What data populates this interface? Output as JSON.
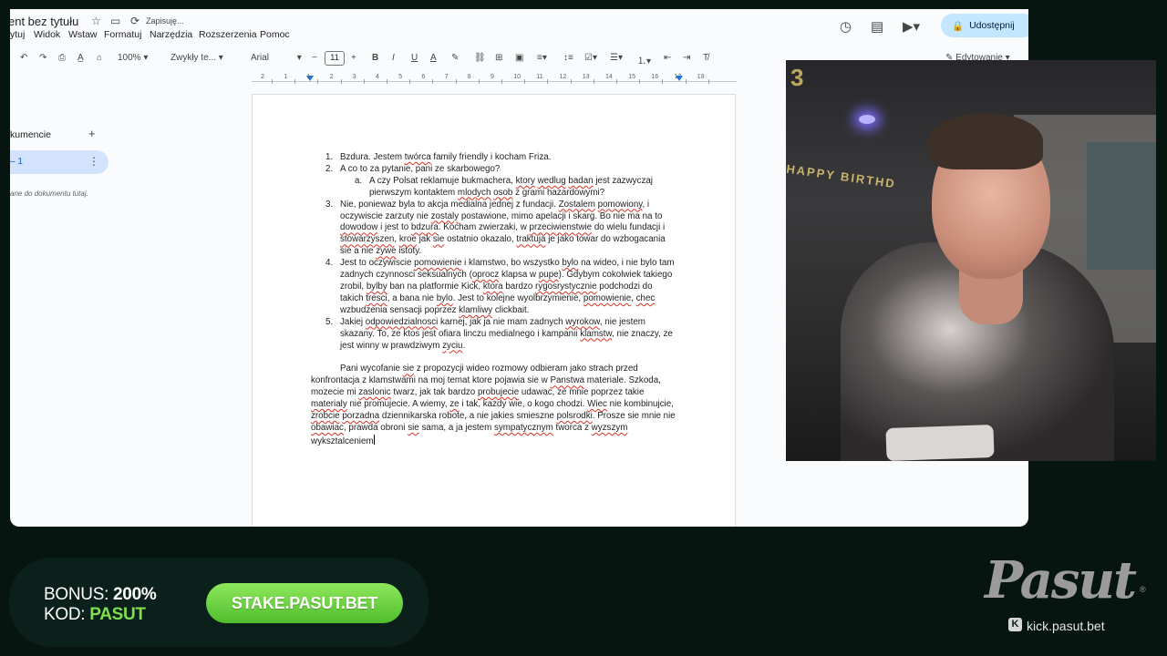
{
  "docs": {
    "title": "ent bez tytułu",
    "saving": "Zapisuję...",
    "menu": [
      "ytuj",
      "Widok",
      "Wstaw",
      "Formatuj",
      "Narzędzia",
      "Rozszerzenia",
      "Pomoc"
    ],
    "share_label": "Udostępnij",
    "edit_mode": "Edytowanie",
    "toolbar": {
      "zoom": "100%",
      "style": "Zwykły te...",
      "font": "Arial",
      "font_size": "11"
    },
    "ruler": [
      "2",
      "1",
      "1",
      "2",
      "3",
      "4",
      "5",
      "6",
      "7",
      "8",
      "9",
      "10",
      "11",
      "12",
      "13",
      "14",
      "15",
      "16",
      "17",
      "18"
    ],
    "outline": {
      "title": "kumencie",
      "item": "– 1",
      "hint": "ane do dokumentu tutaj."
    },
    "body": {
      "items": [
        {
          "num": "1.",
          "text": "Bzdura. Jestem <u>twórca</u> family friendly i kocham Friza."
        },
        {
          "num": "2.",
          "text": "A co to za pytanie, pani ze skarbowego?"
        },
        {
          "num": "a.",
          "text": "A czy Polsat reklamuje bukmachera, <u>ktory</u> <u>wedlug</u> <u>badan</u> jest zazwyczaj pierwszym kontaktem <u>mlodych</u> <u>osob</u> z grami hazardowymi?",
          "sub": true
        },
        {
          "num": "3.",
          "text": "Nie, poniewaz byla to akcja medialna jednej z fundacji. <u>Zostalem</u> <u>pomowiony</u>, i oczywiscie zarzuty nie <u>zostaly</u> postawione, mimo apelacji i skarg. Bo nie ma na to <u>dowodow</u> i jest to <u>bdzura</u>. Kocham zwierzaki, w <u>przeciwienstwie</u> do wielu fundacji i <u>stowarzyszen</u>, <u>kroe</u> jak <u>sie</u> ostatnio okazalo, <u>traktuja</u> je jako towar do wzbogacania sie a nie <u>zywe</u> istoty."
        },
        {
          "num": "4.",
          "text": "Jest to oczywiscie <u>pomowienie</u> i klamstwo, bo wszystko <u>bylo</u> na wideo, i nie bylo tam zadnych czynnosci seksualnych (<u>oprocz</u> klapsa w <u>pupe</u>). Gdybym cokolwiek takiego zrobil, <u>bylby</u> ban na platformie Kick, <u>ktora</u> bardzo <u>rygosrystycznie</u> podchodzi do takich <u>tresci</u>, a bana nie <u>bylo</u>. Jest to kolejne wyolbrzymienie, <u>pomowienie</u>, <u>chec</u> wzbudzenia sensacji poprzez <u>klamliwy</u> clickbait."
        },
        {
          "num": "5.",
          "text": "Jakiej <u>odpowiedzialnosci</u> karnej, jak ja nie mam zadnych <u>wyrokow</u>, nie jestem skazany. To, ze ktos jest ofiara linczu medialnego i kampanii <u>klamstw</u>, nie znaczy, ze jest winny w prawdziwym <u>zyciu</u>."
        }
      ],
      "paragraph": "Pani wycofanie <u>sie</u> z propozycji wideo rozmowy odbieram jako strach przed konfrontacja z klamstwami na moj temat ktore pojawia sie w <u>Panstwa</u> materiale. Szkoda, mozecie mi <u>zaslonic</u> twarz, jak tak bardzo <u>probujecie</u> udawac, ze mnie poprzez takie <u>materialy</u> nie promujecie. A wiemy, <u>ze</u> i tak, kazdy wie, o kogo chodzi. <u>Wiec</u> nie kombinujcie, <u>zrobcie</u> <u>porzadna</u> dziennikarska robote, a nie jakies smieszne <u>polsrodki</u>. Prosze sie mnie nie <u>obawiac</u>, prawda obroni <u>sie</u> sama, a ja jestem <u>sympatycznym</u> tworca z <u>wyzszym</u> wyksztalceniem"
    }
  },
  "webcam": {
    "sign_number": "3",
    "sign_text": "HAPPY BIRTHD"
  },
  "promo": {
    "bonus_label": "BONUS:",
    "bonus_value": "200%",
    "kod_label": "KOD:",
    "kod_value": "PASUT",
    "button": "STAKE.PASUT.BET"
  },
  "logo": {
    "word": "Pasut",
    "registered": "®",
    "kick_url": "kick.pasut.bet"
  },
  "colors": {
    "accent_blue": "#0b57d0",
    "share_bg": "#c2e7ff",
    "promo_green": "#4fbd2c",
    "spellcheck_red": "#d93025"
  }
}
